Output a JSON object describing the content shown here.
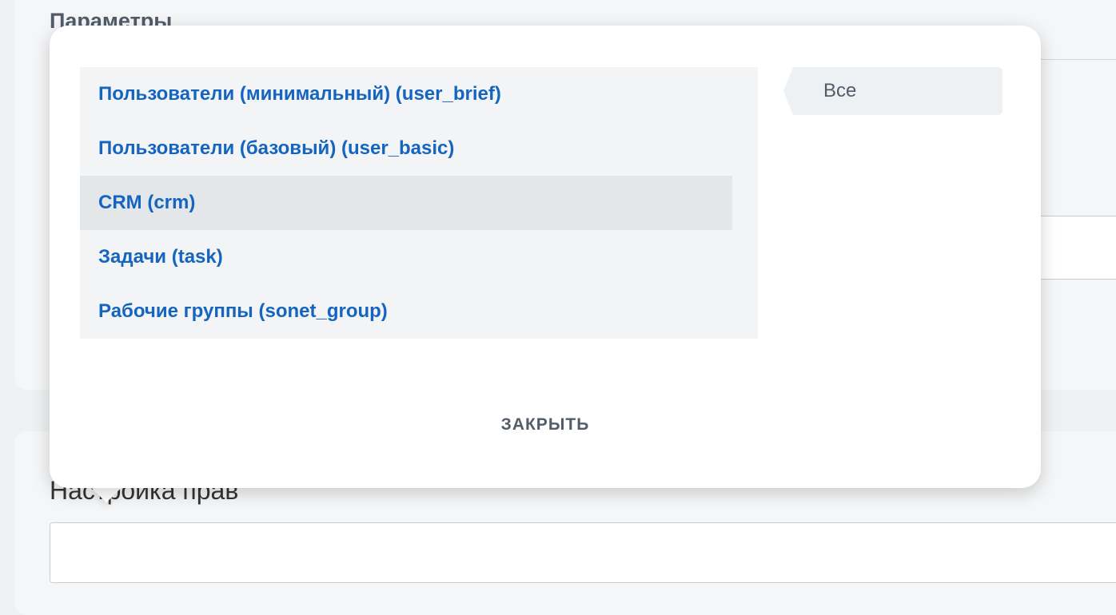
{
  "background": {
    "params_title": "Параметры",
    "rights_title": "Настройка прав"
  },
  "popup": {
    "scopes": [
      {
        "label": "Пользователи (минимальный) (user_brief)"
      },
      {
        "label": "Пользователи (базовый) (user_basic)"
      },
      {
        "label": "CRM (crm)"
      },
      {
        "label": "Задачи (task)"
      },
      {
        "label": "Рабочие группы (sonet_group)"
      }
    ],
    "filter_label": "Все",
    "close_label": "ЗАКРЫТЬ"
  },
  "colors": {
    "link_blue": "#1565c0",
    "list_bg": "#f2f4f5",
    "hover_bg": "#e3e7ea",
    "text_gray": "#535c69"
  }
}
